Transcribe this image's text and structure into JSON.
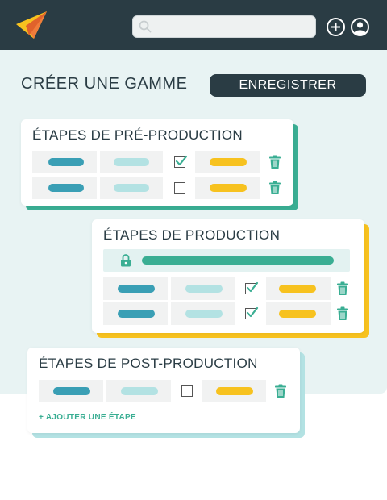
{
  "header": {
    "search_placeholder": ""
  },
  "page": {
    "title": "CRÉER UNE GAMME",
    "save_label": "ENREGISTRER"
  },
  "sections": {
    "pre": {
      "title": "ÉTAPES DE PRÉ-PRODUCTION",
      "rows": [
        {
          "checked": true
        },
        {
          "checked": false
        }
      ]
    },
    "prod": {
      "title": "ÉTAPES DE PRODUCTION",
      "rows": [
        {
          "checked": true
        },
        {
          "checked": true
        }
      ]
    },
    "post": {
      "title": "ÉTAPES DE POST-PRODUCTION",
      "rows": [
        {
          "checked": false
        }
      ],
      "add_label": "+ AJOUTER UNE ÉTAPE"
    }
  },
  "colors": {
    "navy": "#2a3c44",
    "teal": "#3aae93",
    "blue": "#3a9fb5",
    "light_teal": "#b3e2e3",
    "yellow": "#f7c21f",
    "orange": "#f07c3b",
    "background": "#e8f3f3"
  },
  "icons": [
    "paper-plane-logo-icon",
    "search-icon",
    "add-circle-icon",
    "user-avatar-icon",
    "checkbox-check-icon",
    "trash-icon",
    "lock-icon"
  ]
}
